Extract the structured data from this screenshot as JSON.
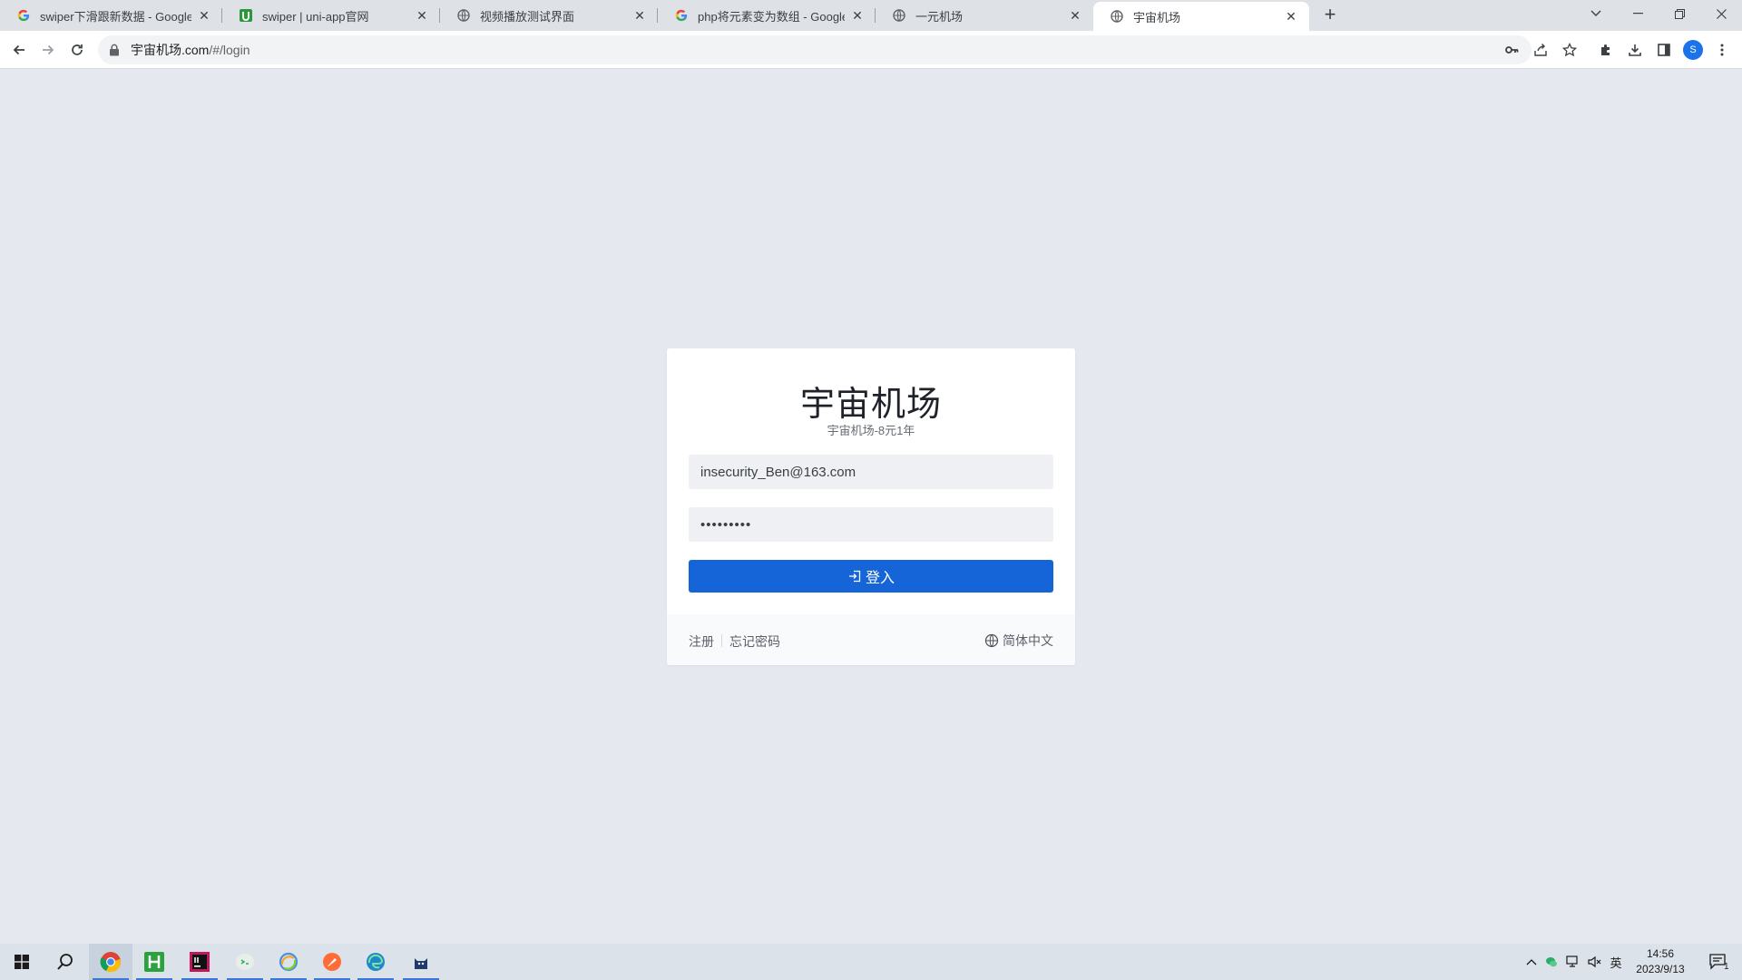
{
  "browser": {
    "tabs": [
      {
        "title": "swiper下滑跟新数据 - Google 搜",
        "favicon": "google-g-icon"
      },
      {
        "title": "swiper | uni-app官网",
        "favicon": "uniapp-icon"
      },
      {
        "title": "视频播放测试界面",
        "favicon": "globe-icon"
      },
      {
        "title": "php将元素变为数组 - Google 搜",
        "favicon": "google-g-icon"
      },
      {
        "title": "一元机场",
        "favicon": "globe-icon"
      },
      {
        "title": "宇宙机场",
        "favicon": "globe-icon",
        "active": true
      }
    ],
    "new_tab": "+",
    "url_host": "宇宙机场.com",
    "url_path": "/#/login",
    "profile_initial": "S"
  },
  "login": {
    "title": "宇宙机场",
    "subtitle": "宇宙机场-8元1年",
    "email_value": "insecurity_Ben@163.com",
    "password_value": "•••••••••",
    "submit_label": "登入",
    "register_link": "注册",
    "forgot_link": "忘记密码",
    "language": "简体中文"
  },
  "taskbar": {
    "apps": [
      "start",
      "search",
      "chrome",
      "hbuilderx",
      "jetbrains-ide",
      "wechat-devtools",
      "browser",
      "postman",
      "edge",
      "app"
    ],
    "ime": "英",
    "time": "14:56",
    "date": "2023/9/13",
    "notification_count": "1"
  },
  "colors": {
    "page_bg": "#e5e8ef",
    "primary_button": "#1565d8",
    "input_bg": "#eef0f3"
  }
}
